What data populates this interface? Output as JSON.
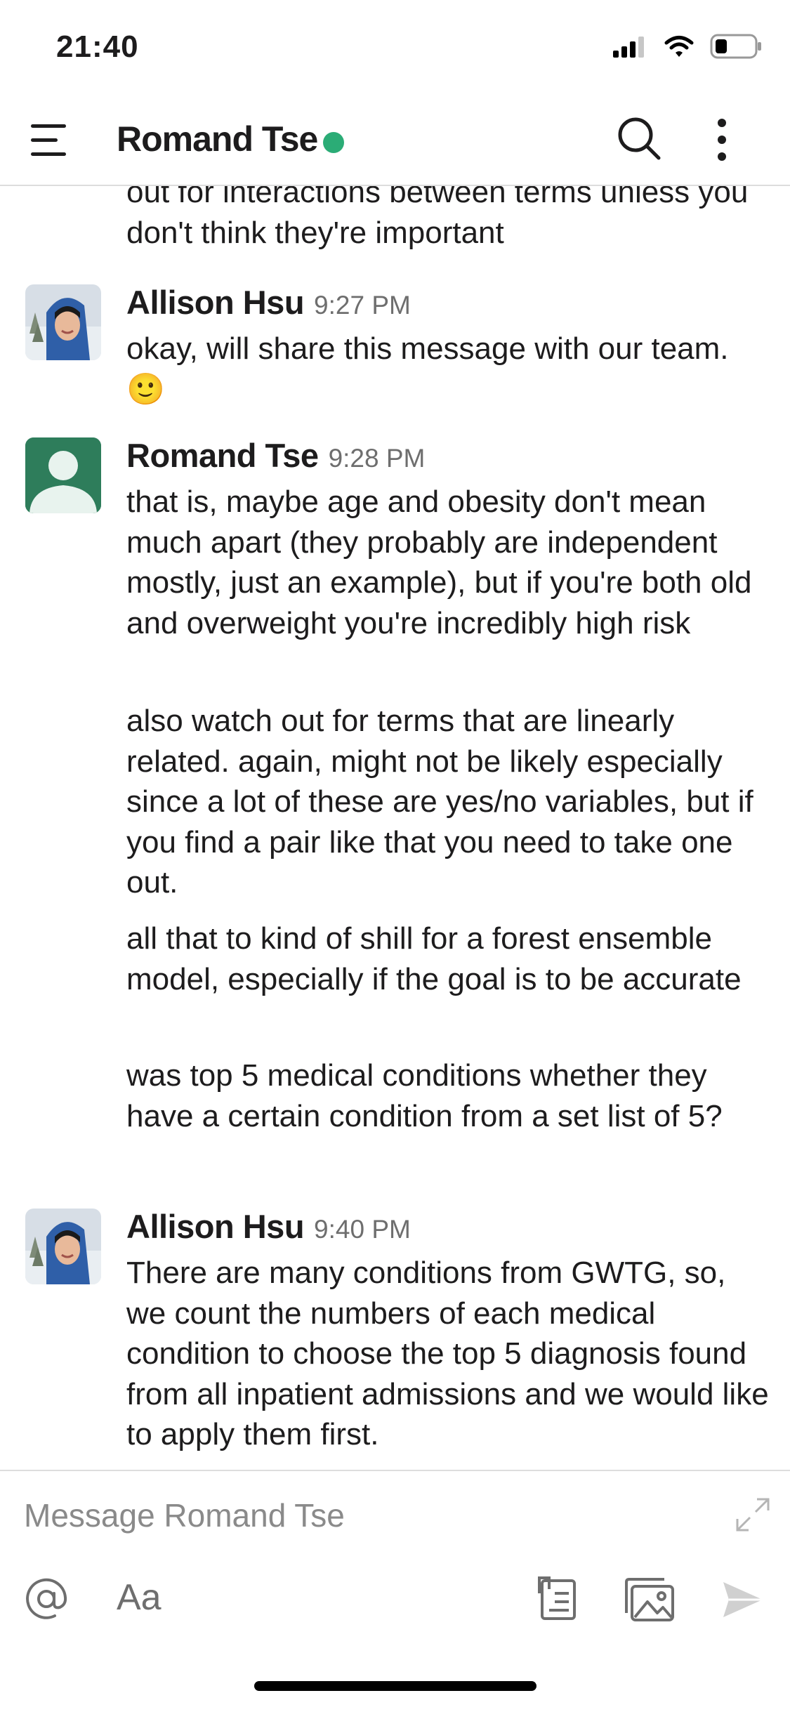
{
  "status_bar": {
    "time": "21:40"
  },
  "header": {
    "title": "Romand Tse"
  },
  "messages": {
    "m0": {
      "text": "out for interactions between terms unless you don't think they're important"
    },
    "m1": {
      "sender": "Allison Hsu",
      "time": "9:27 PM",
      "text": "okay, will share this message with our team. 🙂"
    },
    "m2": {
      "sender": "Romand Tse",
      "time": "9:28 PM",
      "p1": "that is, maybe age and obesity don't mean much apart (they probably are independent mostly, just an example), but if you're both old and overweight you're incredibly high risk",
      "p2": "also watch out for terms that are linearly related.  again, might not be likely especially since a lot of these are yes/no variables, but if you find a pair like that you need to take one out.",
      "p3": "all that to kind of shill for a forest ensemble model, especially if the goal is to be accurate",
      "p4": "was top 5 medical conditions whether they have a certain condition from a set list of 5?"
    },
    "m3": {
      "sender": "Allison Hsu",
      "time": "9:40 PM",
      "text": "There are many conditions from GWTG, so, we count the numbers of each medical condition to choose the top 5 diagnosis found from all inpatient admissions and we would like to apply them first."
    }
  },
  "composer": {
    "placeholder": "Message Romand Tse",
    "format_label": "Aa"
  },
  "colors": {
    "presence": "#2bac76",
    "default_avatar": "#2e7d5b",
    "text": "#1d1c1d",
    "muted": "#6e6e6e"
  },
  "icons": [
    "menu-icon",
    "search-icon",
    "more-vertical-icon",
    "expand-icon",
    "at-icon",
    "files-icon",
    "photos-icon",
    "send-icon",
    "signal-icon",
    "wifi-icon",
    "battery-icon"
  ]
}
